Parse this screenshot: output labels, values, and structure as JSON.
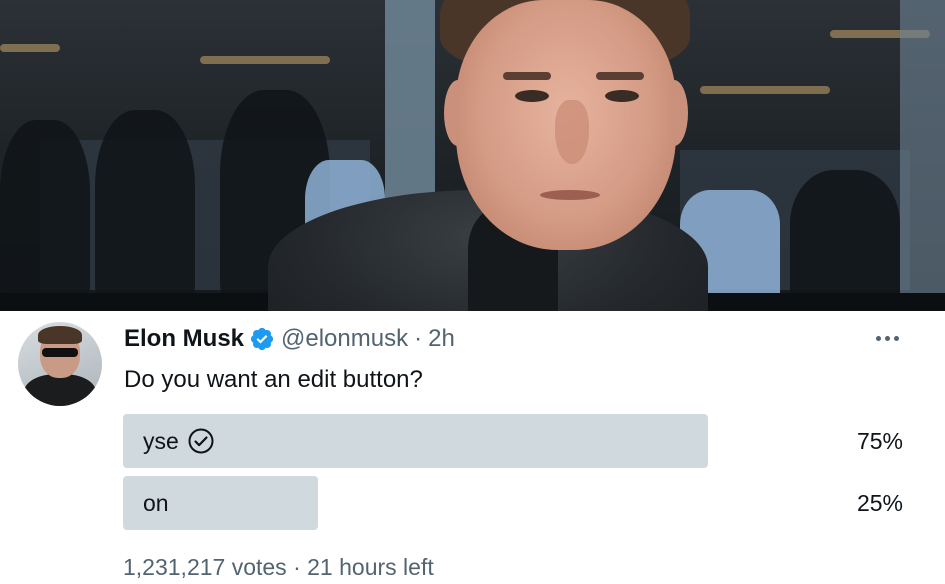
{
  "tweet": {
    "author_name": "Elon Musk",
    "handle": "@elonmusk",
    "separator": "·",
    "time": "2h",
    "text": "Do you want an edit button?",
    "verified_color": "#1d9bf0",
    "icons": {
      "verified": "verified-badge-icon",
      "more": "more-options-icon",
      "check": "check-circle-icon"
    }
  },
  "poll": {
    "options": [
      {
        "label": "yse",
        "percent_label": "75%",
        "percent": 75,
        "winner": true
      },
      {
        "label": "on",
        "percent_label": "25%",
        "percent": 25,
        "winner": false
      }
    ],
    "votes": "1,231,217 votes",
    "separator": "·",
    "time_left": "21 hours left",
    "bar_color": "#cfd9de"
  }
}
